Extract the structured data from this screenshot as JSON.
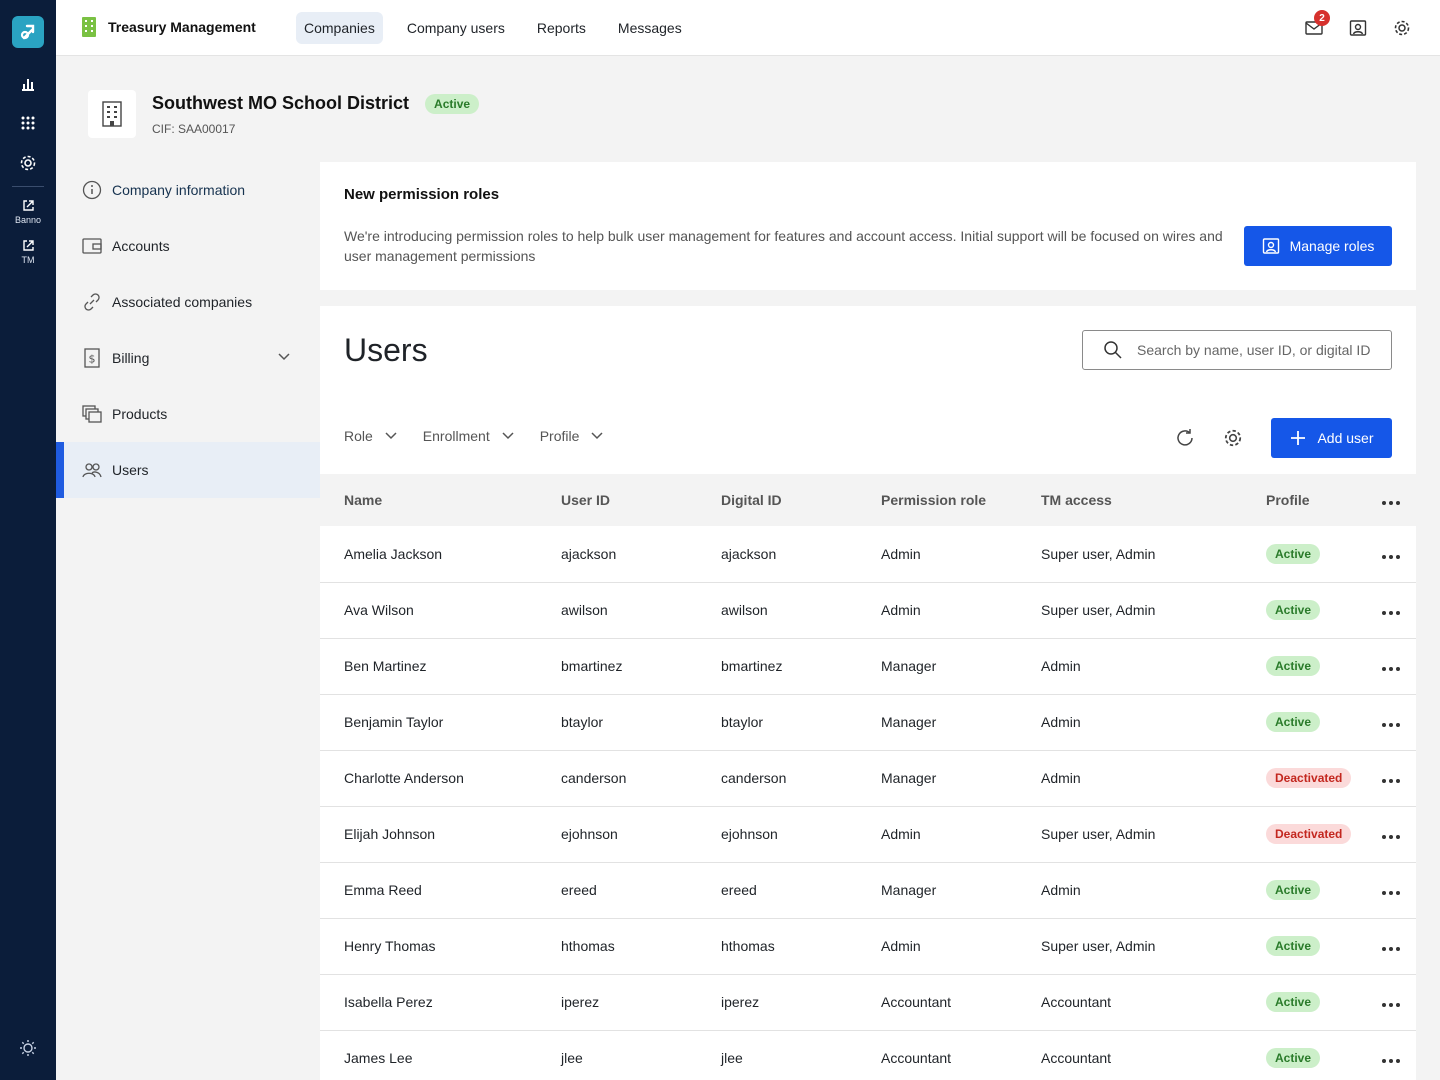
{
  "rail": {
    "banno_label": "Banno",
    "tm_label": "TM"
  },
  "topbar": {
    "app_title": "Treasury Management",
    "tabs": [
      "Companies",
      "Company users",
      "Reports",
      "Messages"
    ],
    "active_tab": "Companies",
    "mail_badge": "2"
  },
  "company": {
    "name": "Southwest MO School District",
    "status": "Active",
    "cif": "CIF: SAA00017"
  },
  "sidebar": {
    "items": [
      {
        "label": "Company information"
      },
      {
        "label": "Accounts"
      },
      {
        "label": "Associated companies"
      },
      {
        "label": "Billing"
      },
      {
        "label": "Products"
      },
      {
        "label": "Users"
      }
    ],
    "active": "Users"
  },
  "banner": {
    "title": "New permission roles",
    "description": "We're introducing permission roles to help bulk user management for features and account access. Initial support will be focused on wires and user management permissions",
    "button": "Manage roles"
  },
  "users": {
    "title": "Users",
    "search_placeholder": "Search by name, user ID, or digital ID",
    "filters": [
      "Role",
      "Enrollment",
      "Profile"
    ],
    "add_button": "Add user",
    "columns": [
      "Name",
      "User ID",
      "Digital ID",
      "Permission role",
      "TM access",
      "Profile"
    ],
    "rows": [
      {
        "name": "Amelia Jackson",
        "user_id": "ajackson",
        "digital_id": "ajackson",
        "role": "Admin",
        "tm_access": "Super user, Admin",
        "profile": "Active"
      },
      {
        "name": "Ava Wilson",
        "user_id": "awilson",
        "digital_id": "awilson",
        "role": "Admin",
        "tm_access": "Super user, Admin",
        "profile": "Active"
      },
      {
        "name": "Ben Martinez",
        "user_id": "bmartinez",
        "digital_id": "bmartinez",
        "role": "Manager",
        "tm_access": "Admin",
        "profile": "Active"
      },
      {
        "name": "Benjamin Taylor",
        "user_id": "btaylor",
        "digital_id": "btaylor",
        "role": "Manager",
        "tm_access": "Admin",
        "profile": "Active"
      },
      {
        "name": "Charlotte Anderson",
        "user_id": "canderson",
        "digital_id": "canderson",
        "role": "Manager",
        "tm_access": "Admin",
        "profile": "Deactivated"
      },
      {
        "name": "Elijah Johnson",
        "user_id": "ejohnson",
        "digital_id": "ejohnson",
        "role": "Admin",
        "tm_access": "Super user, Admin",
        "profile": "Deactivated"
      },
      {
        "name": "Emma Reed",
        "user_id": "ereed",
        "digital_id": "ereed",
        "role": "Manager",
        "tm_access": "Admin",
        "profile": "Active"
      },
      {
        "name": "Henry Thomas",
        "user_id": "hthomas",
        "digital_id": "hthomas",
        "role": "Admin",
        "tm_access": "Super user, Admin",
        "profile": "Active"
      },
      {
        "name": "Isabella Perez",
        "user_id": "iperez",
        "digital_id": "iperez",
        "role": "Accountant",
        "tm_access": "Accountant",
        "profile": "Active"
      },
      {
        "name": "James Lee",
        "user_id": "jlee",
        "digital_id": "jlee",
        "role": "Accountant",
        "tm_access": "Accountant",
        "profile": "Active"
      }
    ]
  },
  "colors": {
    "rail": "#0b1d3a",
    "primary": "#1557e8",
    "active_bg": "#ccefc9",
    "active_text": "#2a7b2a",
    "deactivated_bg": "#fbdada",
    "deactivated_text": "#c3271f"
  },
  "icons": {
    "rail": [
      "app-logo-icon",
      "bar-chart-icon",
      "grid-icon",
      "gear-icon",
      "external-link-icon",
      "external-link-icon",
      "sun-icon"
    ],
    "topbar": [
      "building-icon",
      "mail-icon",
      "user-card-icon",
      "gear-icon"
    ]
  }
}
